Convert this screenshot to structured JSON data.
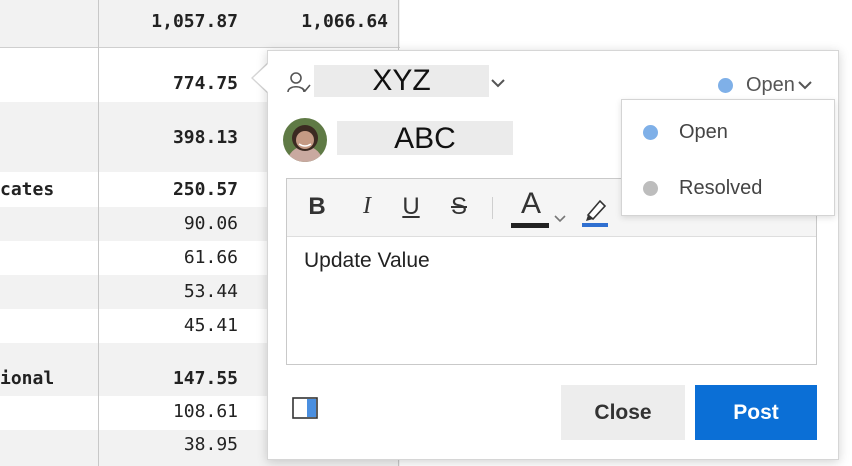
{
  "sheet": {
    "top_row": {
      "col1": "1,057.87",
      "col2": "1,066.64"
    },
    "rows": [
      {
        "label": "",
        "value": "774.75",
        "bold": true
      },
      {
        "label": "",
        "value": "398.13",
        "bold": true
      },
      {
        "label": "cates",
        "value": "250.57",
        "bold": true
      },
      {
        "label": "",
        "value": "90.06",
        "bold": false
      },
      {
        "label": "",
        "value": "61.66",
        "bold": false
      },
      {
        "label": "",
        "value": "53.44",
        "bold": false
      },
      {
        "label": "",
        "value": "45.41",
        "bold": false
      },
      {
        "label": "ional",
        "value": "147.55",
        "bold": true
      },
      {
        "label": "",
        "value": "108.61",
        "bold": false
      },
      {
        "label": "",
        "value": "38.95",
        "bold": false
      }
    ]
  },
  "comment": {
    "assignee": "XYZ",
    "author": "ABC",
    "status": {
      "label": "Open",
      "color": "#7fb0e8"
    },
    "status_options": [
      {
        "label": "Open",
        "color": "#7fb0e8"
      },
      {
        "label": "Resolved",
        "color": "#bdbdbd"
      }
    ],
    "toolbar": {
      "bold": "B",
      "italic": "I",
      "underline": "U",
      "strike": "S",
      "font_color": "A",
      "font_color_swatch": "#222222",
      "highlight_swatch": "#2f6fd0"
    },
    "body_text": "Update Value",
    "close_label": "Close",
    "post_label": "Post"
  },
  "colors": {
    "accent": "#0b6fd6"
  }
}
